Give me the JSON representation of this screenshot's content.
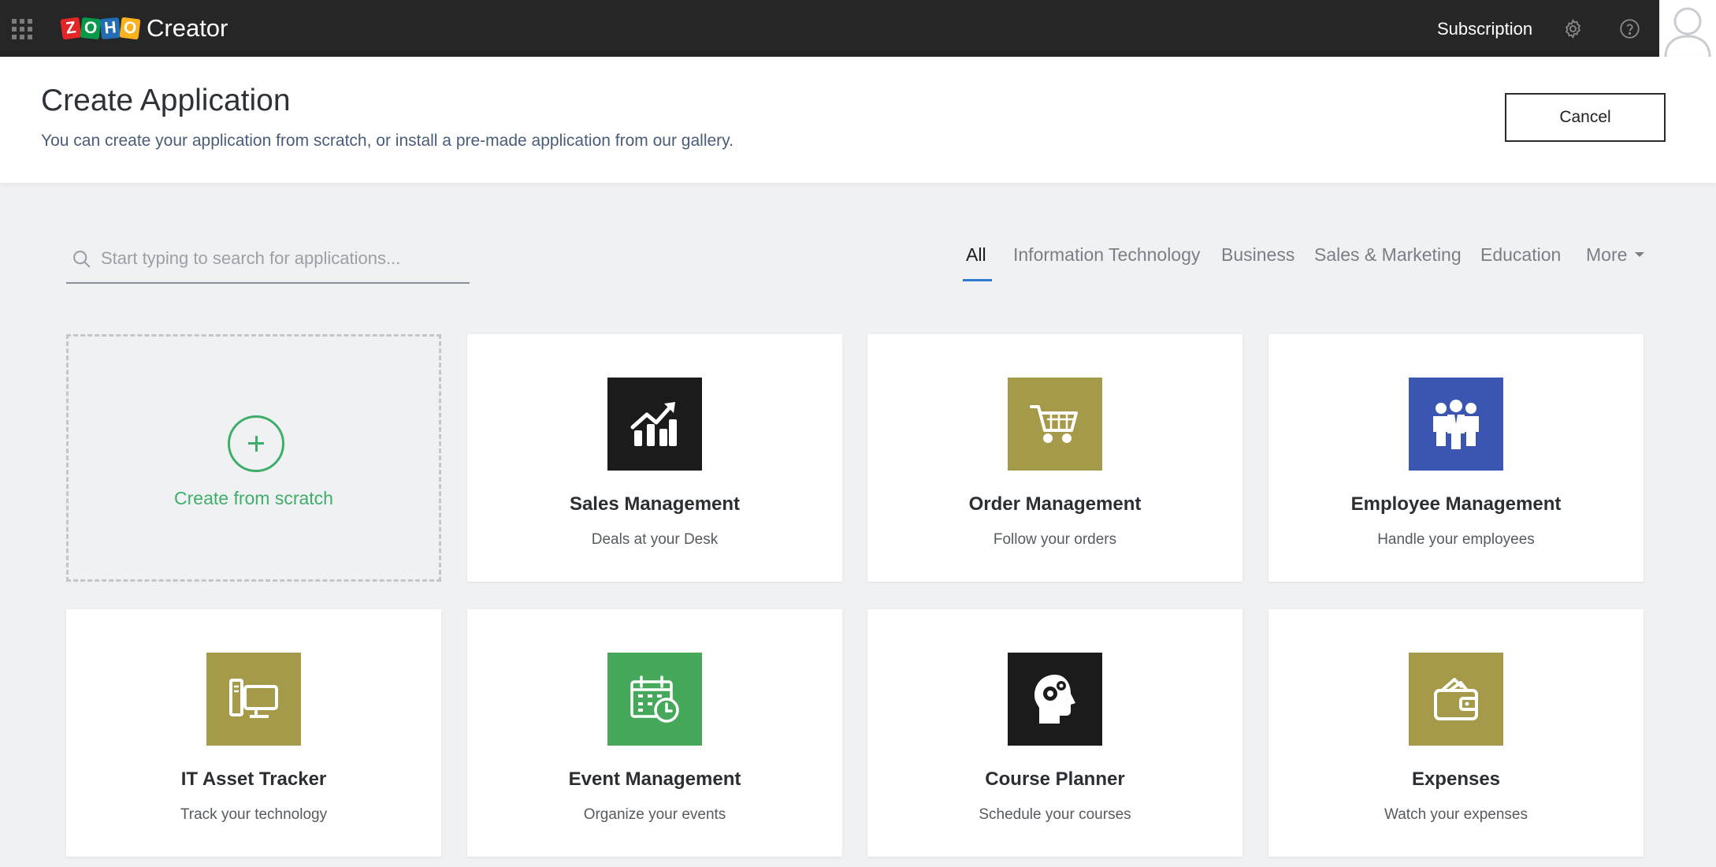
{
  "topbar": {
    "logo_letters": [
      "Z",
      "O",
      "H",
      "O"
    ],
    "logo_colors": [
      "#e42527",
      "#089949",
      "#226db4",
      "#f9b21d"
    ],
    "product_name": "Creator",
    "subscription_label": "Subscription",
    "icons": [
      "apps-grid-icon",
      "gear-icon",
      "help-icon",
      "avatar"
    ]
  },
  "header": {
    "title": "Create Application",
    "subtitle": "You can create your application from scratch, or install a pre-made application from our gallery.",
    "cancel_label": "Cancel"
  },
  "search": {
    "placeholder": "Start typing to search for applications...",
    "value": ""
  },
  "tabs": [
    {
      "label": "All",
      "active": true
    },
    {
      "label": "Information Technology",
      "active": false
    },
    {
      "label": "Business",
      "active": false
    },
    {
      "label": "Sales & Marketing",
      "active": false
    },
    {
      "label": "Education",
      "active": false
    },
    {
      "label": "More",
      "active": false
    }
  ],
  "accent_color": "#2f7bd1",
  "scratch_card": {
    "label": "Create from scratch",
    "color": "#3fae6a"
  },
  "apps": [
    {
      "title": "Sales Management",
      "desc": "Deals at your Desk",
      "icon": "chart-growth-icon",
      "color": "#1b1b1b"
    },
    {
      "title": "Order Management",
      "desc": "Follow your orders",
      "icon": "shopping-cart-icon",
      "color": "#a59a4a"
    },
    {
      "title": "Employee Management",
      "desc": "Handle your employees",
      "icon": "team-icon",
      "color": "#3a56b0"
    },
    {
      "title": "IT Asset Tracker",
      "desc": "Track your technology",
      "icon": "computer-icon",
      "color": "#a59a4a"
    },
    {
      "title": "Event Management",
      "desc": "Organize your events",
      "icon": "calendar-clock-icon",
      "color": "#46a85a"
    },
    {
      "title": "Course Planner",
      "desc": "Schedule your courses",
      "icon": "head-gears-icon",
      "color": "#1b1b1b"
    },
    {
      "title": "Expenses",
      "desc": "Watch your expenses",
      "icon": "wallet-icon",
      "color": "#a59a4a"
    }
  ]
}
